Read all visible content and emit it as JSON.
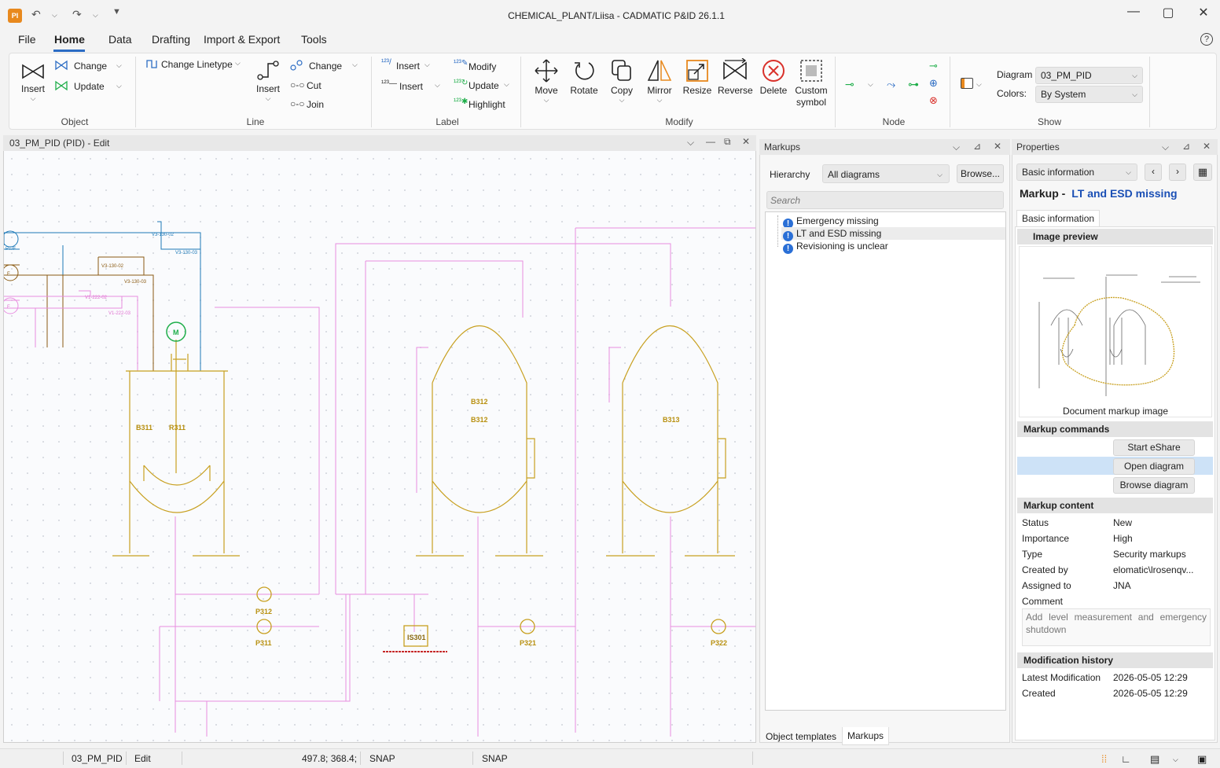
{
  "app": {
    "logo_text": "PI",
    "title": "CHEMICAL_PLANT/Liisa - CADMATIC P&ID 26.1.1",
    "window_controls": [
      "minimize-icon",
      "maximize-icon",
      "close-icon"
    ]
  },
  "menu": {
    "tabs": [
      "File",
      "Home",
      "Data",
      "Drafting",
      "Import & Export",
      "Tools"
    ],
    "active": "Home"
  },
  "ribbon": {
    "object": {
      "group": "Object",
      "insert": "Insert",
      "change": "Change",
      "update": "Update"
    },
    "line": {
      "group": "Line",
      "change_linetype": "Change Linetype",
      "insert": "Insert",
      "change": "Change",
      "cut": "Cut",
      "join": "Join"
    },
    "label": {
      "group": "Label",
      "insert1": "Insert",
      "insert2": "Insert",
      "modify": "Modify",
      "update": "Update",
      "highlight": "Highlight"
    },
    "modify": {
      "group": "Modify",
      "move": "Move",
      "rotate": "Rotate",
      "copy": "Copy",
      "mirror": "Mirror",
      "resize": "Resize",
      "reverse": "Reverse",
      "delete": "Delete",
      "custom_symbol_1": "Custom",
      "custom_symbol_2": "symbol"
    },
    "node": {
      "group": "Node"
    },
    "show": {
      "group": "Show",
      "diagram_label": "Diagram",
      "diagram_value": "03_PM_PID",
      "colors_label": "Colors:",
      "colors_value": "By System"
    }
  },
  "canvas": {
    "tab_title": "03_PM_PID (PID) - Edit",
    "equipment": {
      "b311_a": "B311",
      "b311_b": "R311",
      "b312_a": "B312",
      "b312_b": "B312",
      "b313": "B313",
      "p311": "P311",
      "p312": "P312",
      "p321": "P321",
      "p322": "P322",
      "is301": "IS301",
      "motor": "M"
    },
    "valve_tags": [
      "V3-130-02",
      "V3-130-03",
      "V3-130-02",
      "V3-130-03",
      "V1-222-02",
      "V1-222-03"
    ],
    "instrument_tags": [
      "PT/F",
      "F",
      "F"
    ]
  },
  "markups": {
    "title": "Markups",
    "hierarchy_label": "Hierarchy",
    "hierarchy_value": "All diagrams",
    "browse_button": "Browse...",
    "search_placeholder": "Search",
    "items": [
      "Emergency missing",
      "LT and ESD missing",
      "Revisioning is unclear"
    ],
    "selected_index": 1,
    "bottom_tabs": [
      "Object templates",
      "Markups"
    ],
    "active_bottom_tab": "Markups"
  },
  "properties": {
    "title": "Properties",
    "category": "Basic information",
    "heading_prefix": "Markup -",
    "heading_name": "LT and ESD missing",
    "subtab": "Basic information",
    "image_preview": {
      "title": "Image preview",
      "caption": "Document markup image"
    },
    "markup_commands": {
      "title": "Markup commands",
      "buttons": [
        "Start eShare",
        "Open diagram",
        "Browse diagram"
      ],
      "highlighted_index": 1
    },
    "markup_content": {
      "title": "Markup content",
      "rows": [
        {
          "k": "Status",
          "v": "New"
        },
        {
          "k": "Importance",
          "v": "High"
        },
        {
          "k": "Type",
          "v": "Security markups"
        },
        {
          "k": "Created by",
          "v": "elomatic\\lrosenqv..."
        },
        {
          "k": "Assigned to",
          "v": "JNA"
        }
      ],
      "comment_label": "Comment",
      "comment_text": "Add level measurement and emergency shutdown"
    },
    "modification_history": {
      "title": "Modification history",
      "rows": [
        {
          "k": "Latest Modification",
          "v": "2026-05-05 12:29"
        },
        {
          "k": "Created",
          "v": "2026-05-05 12:29"
        }
      ]
    }
  },
  "statusbar": {
    "diagram": "03_PM_PID",
    "mode": "Edit",
    "coords": "497.8; 368.4;",
    "snap1": "SNAP",
    "snap2": "SNAP"
  },
  "colors": {
    "accent": "#2b6cc4",
    "equipment": "#c8a020",
    "process_line": "#e88ee0",
    "utility_blue": "#1e7ab8",
    "utility_brown": "#8a5a12",
    "node_green": "#1fae4a",
    "markup_link": "#1a4fb5"
  }
}
